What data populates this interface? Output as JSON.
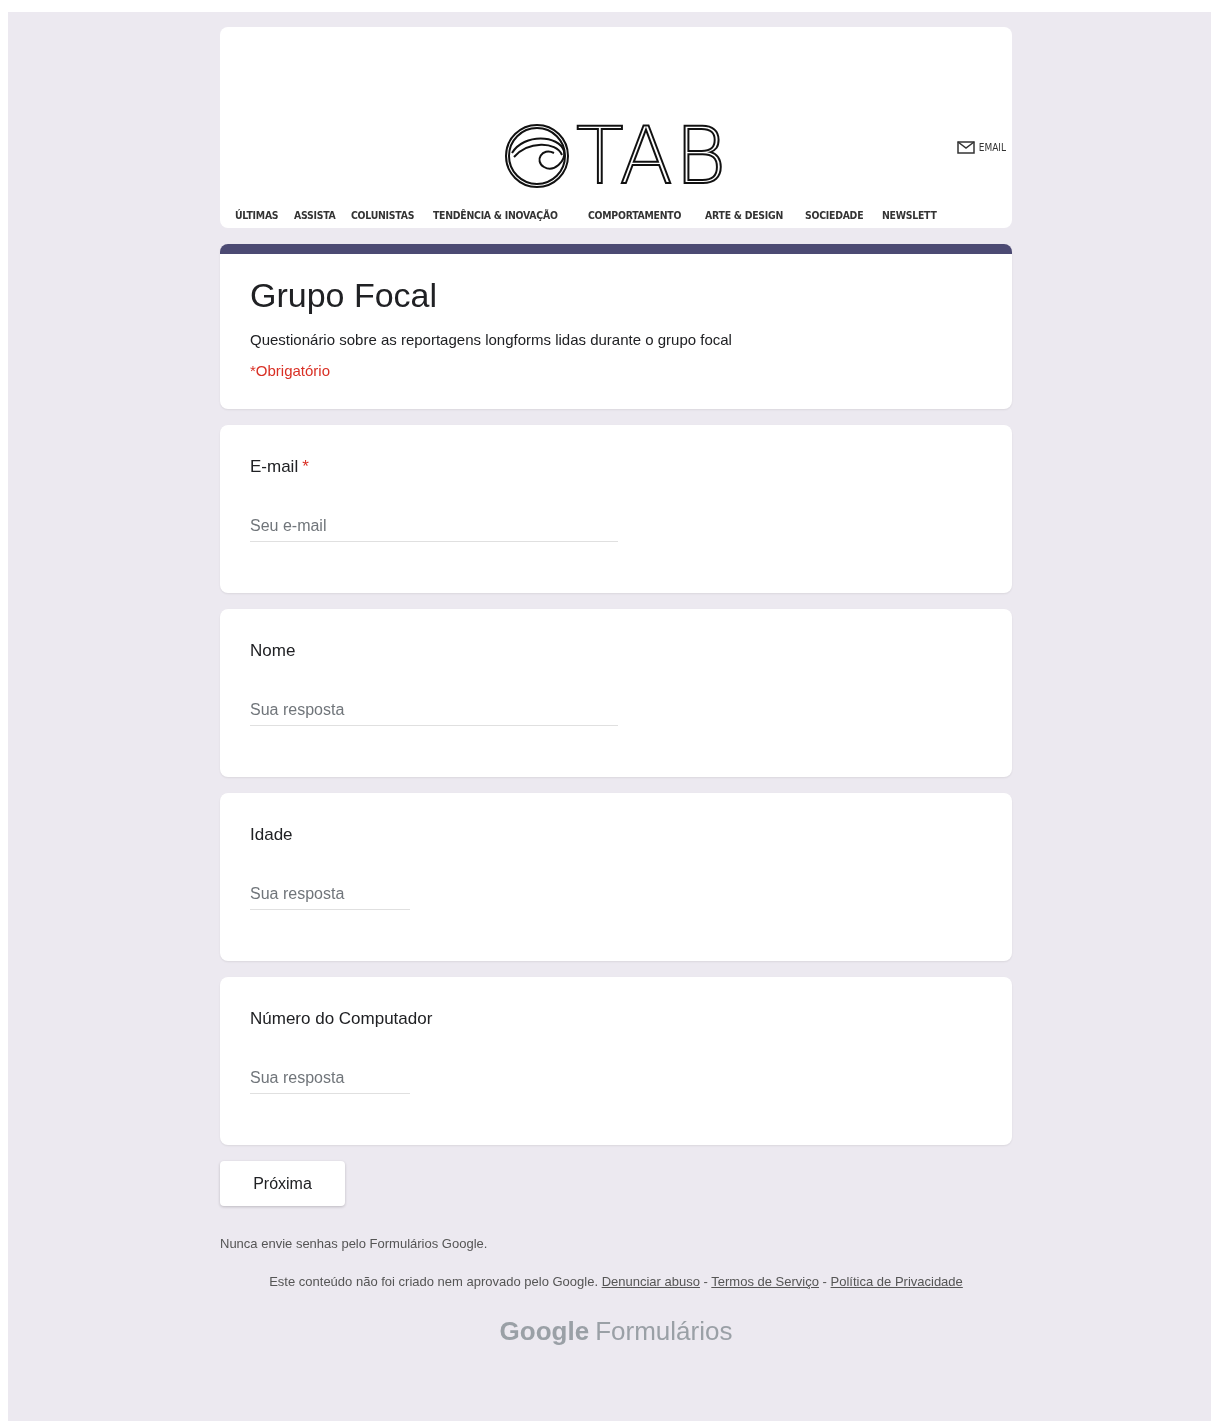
{
  "banner": {
    "logo": "TAB",
    "email_link": "EMAIL",
    "nav": [
      "ÚLTIMAS",
      "ASSISTA",
      "COLUNISTAS",
      "TENDÊNCIA & INOVAÇÃO",
      "COMPORTAMENTO",
      "ARTE & DESIGN",
      "SOCIEDADE",
      "NEWSLETT"
    ]
  },
  "form": {
    "title": "Grupo Focal",
    "description": "Questionário sobre as reportagens longforms lidas durante o grupo focal",
    "required_note": "*Obrigatório",
    "required_mark": "*"
  },
  "questions": [
    {
      "label": "E-mail",
      "required": true,
      "placeholder": "Seu e-mail",
      "kind": "long"
    },
    {
      "label": "Nome",
      "required": false,
      "placeholder": "Sua resposta",
      "kind": "long"
    },
    {
      "label": "Idade",
      "required": false,
      "placeholder": "Sua resposta",
      "kind": "short"
    },
    {
      "label": "Número do Computador",
      "required": false,
      "placeholder": "Sua resposta",
      "kind": "short"
    }
  ],
  "next_button": "Próxima",
  "footer": {
    "warning": "Nunca envie senhas pelo Formulários Google.",
    "disclaimer": "Este conteúdo não foi criado nem aprovado pelo Google.",
    "links": [
      "Denunciar abuso",
      "Termos de Serviço",
      "Política de Privacidade"
    ],
    "link_separator": "-",
    "brand_google": "Google",
    "brand_product": "Formulários"
  }
}
